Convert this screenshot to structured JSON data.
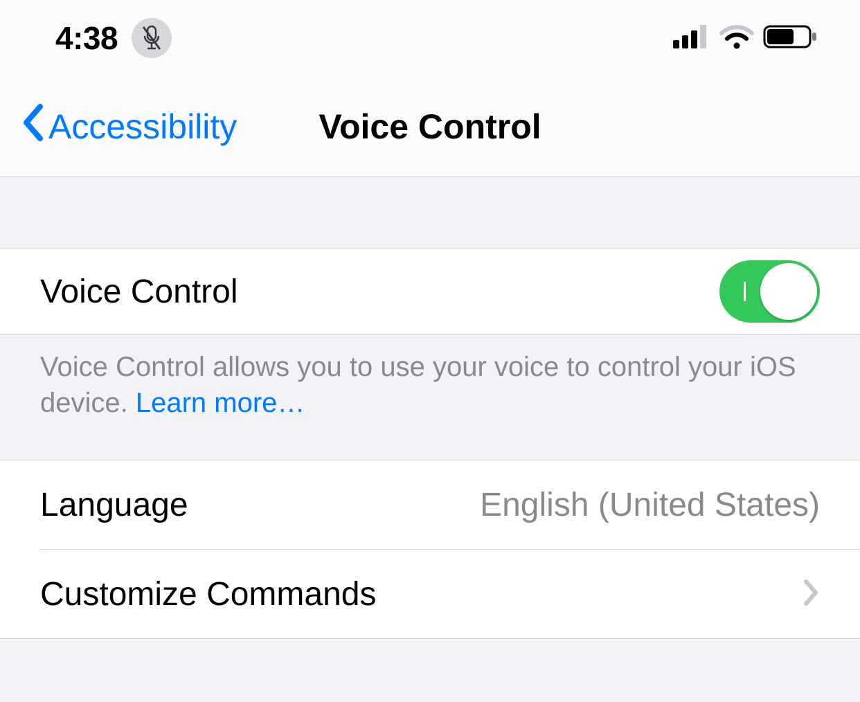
{
  "status_bar": {
    "time": "4:38"
  },
  "nav": {
    "back_label": "Accessibility",
    "title": "Voice Control"
  },
  "rows": {
    "voice_control": {
      "label": "Voice Control",
      "enabled": true
    },
    "footer": {
      "text": "Voice Control allows you to use your voice to control your iOS device. ",
      "link": "Learn more…"
    },
    "language": {
      "label": "Language",
      "value": "English (United States)"
    },
    "customize": {
      "label": "Customize Commands"
    }
  }
}
